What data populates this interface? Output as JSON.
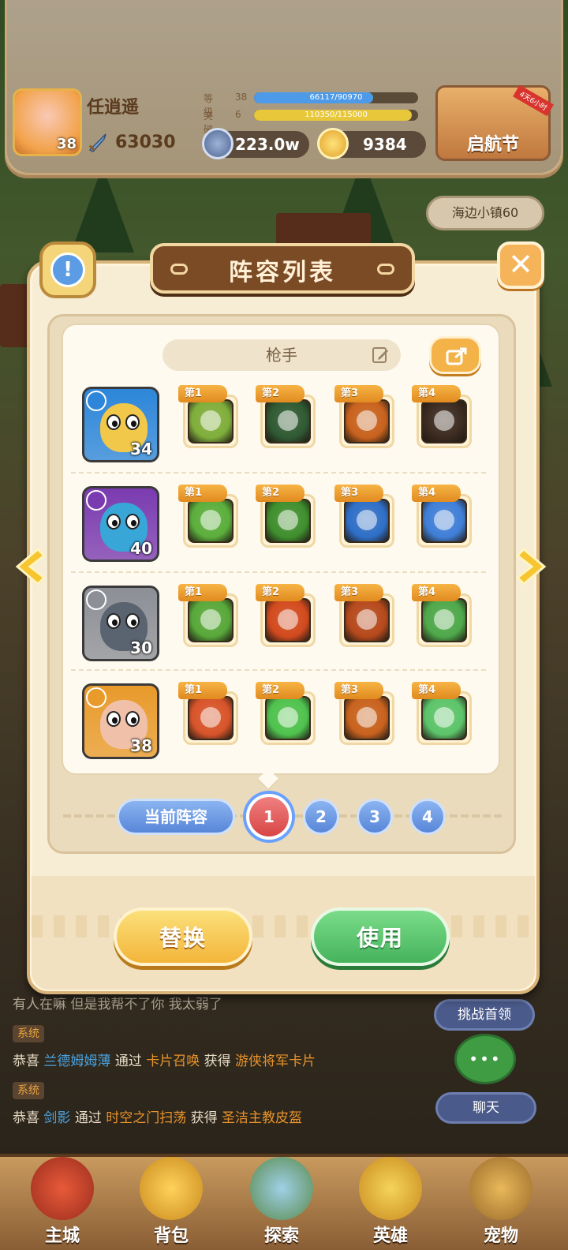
{
  "player": {
    "name": "任逍遥",
    "level": "38",
    "power": "63030",
    "level_label": "等级",
    "level_value": "38",
    "level_progress_text": "66117/90970",
    "level_progress": 0.727,
    "breakthrough_label": "突破",
    "breakthrough_value": "6",
    "breakthrough_progress_text": "110350/115000",
    "breakthrough_progress": 0.96
  },
  "currency": {
    "silver": "223.0w",
    "gold": "9384"
  },
  "event": {
    "label": "启航节",
    "ribbon": "4天6小时"
  },
  "location": "海边小镇60",
  "modal": {
    "title": "阵容列表",
    "info_label": "!",
    "close_label": "✕",
    "team_name": "枪手",
    "rows": [
      {
        "hero_level": "34",
        "hero_color": "#2d86d9",
        "skills": [
          {
            "tag": "第1",
            "color": "#7fae3b"
          },
          {
            "tag": "第2",
            "color": "#2f5a33"
          },
          {
            "tag": "第3",
            "color": "#c8621e"
          },
          {
            "tag": "第4",
            "color": "#3b2a20"
          }
        ]
      },
      {
        "hero_level": "40",
        "hero_color": "#7a3bb0",
        "skills": [
          {
            "tag": "第1",
            "color": "#5bae3c"
          },
          {
            "tag": "第2",
            "color": "#3f8f2e"
          },
          {
            "tag": "第3",
            "color": "#2f6fc8"
          },
          {
            "tag": "第4",
            "color": "#3f7fd8"
          }
        ]
      },
      {
        "hero_level": "30",
        "hero_color": "#8c8f96",
        "skills": [
          {
            "tag": "第1",
            "color": "#58a83a"
          },
          {
            "tag": "第2",
            "color": "#d24a1e"
          },
          {
            "tag": "第3",
            "color": "#b5491c"
          },
          {
            "tag": "第4",
            "color": "#4ea84a"
          }
        ]
      },
      {
        "hero_level": "38",
        "hero_color": "#e89a2b",
        "skills": [
          {
            "tag": "第1",
            "color": "#d8542a"
          },
          {
            "tag": "第2",
            "color": "#4fc24e"
          },
          {
            "tag": "第3",
            "color": "#c8621e"
          },
          {
            "tag": "第4",
            "color": "#5cc46a"
          }
        ]
      }
    ],
    "current_label": "当前阵容",
    "pages": [
      "1",
      "2",
      "3",
      "4"
    ],
    "replace_label": "替换",
    "use_label": "使用"
  },
  "chat": {
    "partial_line": "有人在嘛 但是我帮不了你 我太弱了",
    "system_tag": "系统",
    "msg1": {
      "prefix": "恭喜",
      "name": "兰德姆姆薄",
      "mid": "通过",
      "source": "卡片召唤",
      "get": "获得",
      "item": "游侠将军卡片"
    },
    "msg2": {
      "prefix": "恭喜",
      "name": "剑影",
      "mid": "通过",
      "source": "时空之门扫荡",
      "get": "获得",
      "item": "圣洁主教皮盔"
    }
  },
  "side_buttons": {
    "challenge": "挑战首领",
    "chat": "聊天"
  },
  "nav": [
    "主城",
    "背包",
    "探索",
    "英雄",
    "宠物"
  ]
}
